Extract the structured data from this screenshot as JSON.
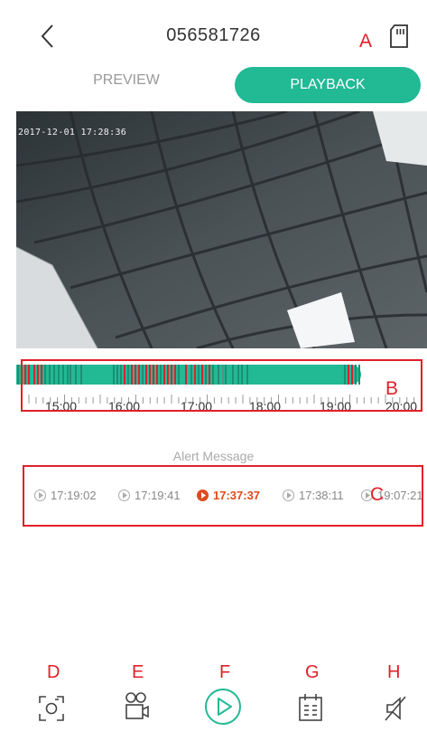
{
  "header": {
    "title": "056581726"
  },
  "tabs": [
    {
      "label": "PREVIEW",
      "active": false
    },
    {
      "label": "PLAYBACK",
      "active": true
    }
  ],
  "video": {
    "timestamp": "2017-12-01 17:28:36"
  },
  "timeline": {
    "labels": [
      "15:00",
      "16:00",
      "17:00",
      "18:00",
      "19:00",
      "20:00"
    ],
    "progress": 0.84,
    "accent_color": "#22b995",
    "event_color": "#d9232f"
  },
  "alert": {
    "title": "Alert Message",
    "events": [
      {
        "time": "17:19:02",
        "active": false
      },
      {
        "time": "17:19:41",
        "active": false
      },
      {
        "time": "17:37:37",
        "active": true
      },
      {
        "time": "17:38:11",
        "active": false
      },
      {
        "time": "19:07:21",
        "active": false
      }
    ]
  },
  "annotations": {
    "A": "A",
    "B": "B",
    "C": "C",
    "D": "D",
    "E": "E",
    "F": "F",
    "G": "G",
    "H": "H"
  },
  "toolbar": {
    "icons": [
      "screenshot-icon",
      "record-icon",
      "play-icon",
      "calendar-icon",
      "mute-icon"
    ]
  }
}
